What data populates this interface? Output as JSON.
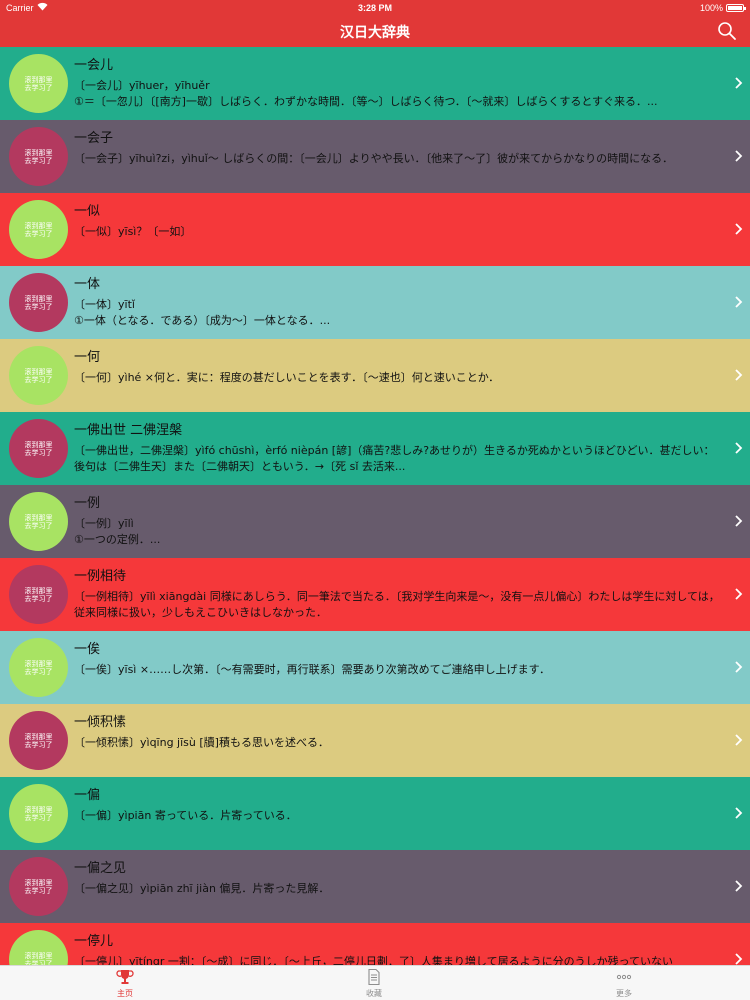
{
  "status_bar": {
    "carrier": "Carrier",
    "time": "3:28 PM",
    "battery": "100%"
  },
  "nav": {
    "title": "汉日大辞典",
    "search_icon": "search-icon"
  },
  "badge_text": "滚到那里去学习了",
  "colors": {
    "nav": "#e13837",
    "rows": {
      "teal": "#22ad8c",
      "purple": "#675b6c",
      "red": "#f5383a",
      "aqua": "#82cac8",
      "tan": "#dccb80"
    },
    "badges": {
      "lime": "#a8e363",
      "magenta": "#b3395f"
    }
  },
  "entries": [
    {
      "word": "一会儿",
      "definition": "〔一会儿〕yīhuer，yīhuěr\n①＝〔一忽儿〕〔[南方]一歇〕しばらく．わずかな時間．〔等～〕しばらく待つ．〔～就来〕しばらくするとすぐ来る．..."
    },
    {
      "word": "一会子",
      "definition": "〔一会子〕yīhuì?zi，yìhuǐ～ しばらくの間：〔一会儿〕よりやや長い．〔他来了～了〕彼が来てからかなりの時間になる．"
    },
    {
      "word": "一似",
      "definition": "〔一似〕yīsì？〔一如〕"
    },
    {
      "word": "一体",
      "definition": "〔一体〕yītǐ\n①一体（となる．である）〔成为～〕一体となる．..."
    },
    {
      "word": "一何",
      "definition": "〔一何〕yìhé ×何と．実に：程度の甚だしいことを表す．〔～速也〕何と速いことか．"
    },
    {
      "word": "一佛出世 二佛涅槃",
      "definition": "〔一佛出世，二佛涅槃〕yìfó chūshì，èrfó nièpán [諺]（痛苦?悲しみ?あせりが）生きるか死ぬかというほどひどい．甚だしい：後句は〔二佛生天〕また〔二佛朝天〕ともいう．→〔死 sǐ 去活来..."
    },
    {
      "word": "一例",
      "definition": "〔一例〕yīlì\n①一つの定例．..."
    },
    {
      "word": "一例相待",
      "definition": "〔一例相待〕yīlì xiāngdài 同様にあしらう．同一筆法で当たる．〔我对学生向来是～，没有一点儿偏心〕わたしは学生に対しては，従来同様に扱い，少しもえこひいきはしなかった．"
    },
    {
      "word": "一俟",
      "definition": "〔一俟〕yīsì ×……し次第．〔～有需要时，再行联系〕需要あり次第改めてご連絡申し上げます．"
    },
    {
      "word": "一倾积愫",
      "definition": "〔一倾积愫〕yìqīng jīsù [牘]積もる思いを述べる．"
    },
    {
      "word": "一偏",
      "definition": "〔一偏〕yìpiān 寄っている．片寄っている．"
    },
    {
      "word": "一偏之见",
      "definition": "〔一偏之见〕yìpiān zhī jiàn 偏見．片寄った見解．"
    },
    {
      "word": "一停儿",
      "definition": "〔一停儿〕yītíngr 一割：〔～成〕に同じ．〔～上丘，二停儿日劃．了〕人集まり増して居るように分のうしか残っていない"
    }
  ],
  "tabs": [
    {
      "label": "主页",
      "icon": "trophy-icon"
    },
    {
      "label": "收藏",
      "icon": "document-icon"
    },
    {
      "label": "更多",
      "icon": "more-icon"
    }
  ]
}
